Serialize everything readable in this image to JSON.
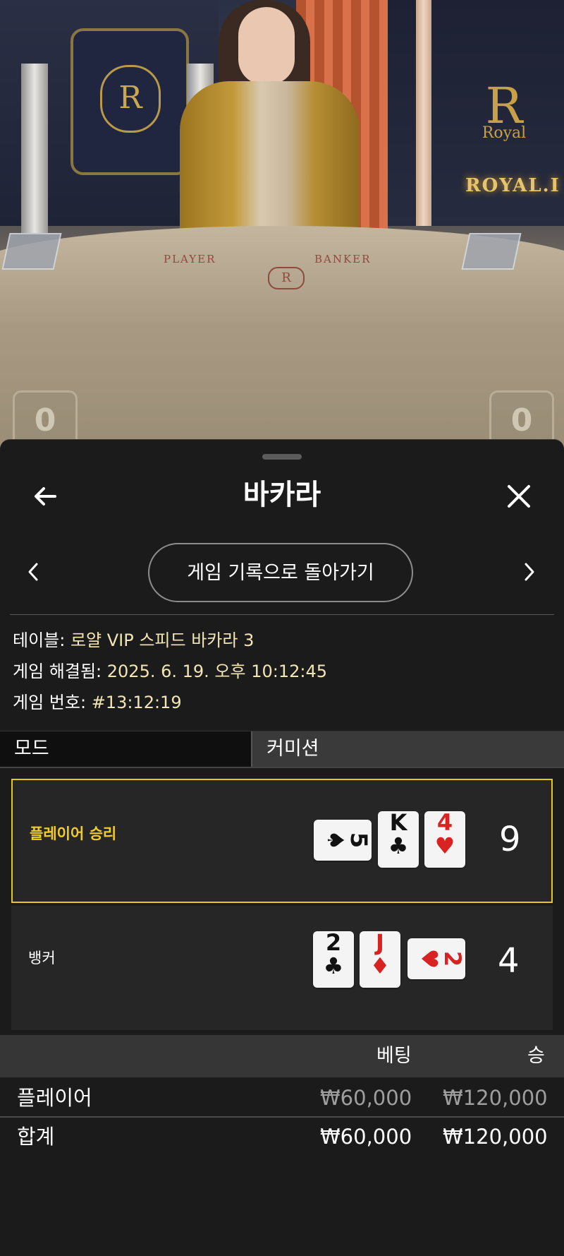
{
  "video": {
    "table_player_label": "PLAYER",
    "table_banker_label": "BANKER",
    "brand_sign": "ROYAL.I",
    "crest_letter": "R",
    "crest_word": "Royal",
    "player_score": "0",
    "banker_score": "0"
  },
  "header": {
    "title": "바카라",
    "back_icon": "arrow-left-icon",
    "close_icon": "close-icon"
  },
  "nav": {
    "back_to_history_label": "게임 기록으로 돌아가기",
    "prev_icon": "chevron-left-icon",
    "next_icon": "chevron-right-icon"
  },
  "info": {
    "table_key": "테이블:",
    "table_value": "로얄 VIP 스피드 바카라 3",
    "resolved_key": "게임 해결됨:",
    "resolved_value": "2025. 6. 19. 오후 10:12:45",
    "game_no_key": "게임 번호:",
    "game_no_value": "#13:12:19"
  },
  "tabs": {
    "mode": "모드",
    "commission": "커미션"
  },
  "results": {
    "player": {
      "label": "플레이어 승리",
      "score": "9",
      "winner": true,
      "cards": [
        {
          "rank": "5",
          "suit": "♠",
          "color": "black",
          "orientation": "horizontal"
        },
        {
          "rank": "K",
          "suit": "♣",
          "color": "black",
          "orientation": "vertical"
        },
        {
          "rank": "4",
          "suit": "♥",
          "color": "red",
          "orientation": "vertical"
        }
      ]
    },
    "banker": {
      "label": "뱅커",
      "score": "4",
      "winner": false,
      "cards": [
        {
          "rank": "2",
          "suit": "♣",
          "color": "black",
          "orientation": "vertical"
        },
        {
          "rank": "J",
          "suit": "♦",
          "color": "red",
          "orientation": "vertical"
        },
        {
          "rank": "2",
          "suit": "♥",
          "color": "red",
          "orientation": "horizontal"
        }
      ]
    }
  },
  "bets": {
    "col_bet": "베팅",
    "col_win": "승",
    "rows": [
      {
        "name": "플레이어",
        "bet": "₩60,000",
        "win": "₩120,000"
      }
    ],
    "total": {
      "name": "합계",
      "bet": "₩60,000",
      "win": "₩120,000"
    }
  },
  "colors": {
    "winner_border": "#e6c623",
    "info_value": "#f3e6b5",
    "card_red": "#d92222",
    "background": "#1b1b1b"
  }
}
